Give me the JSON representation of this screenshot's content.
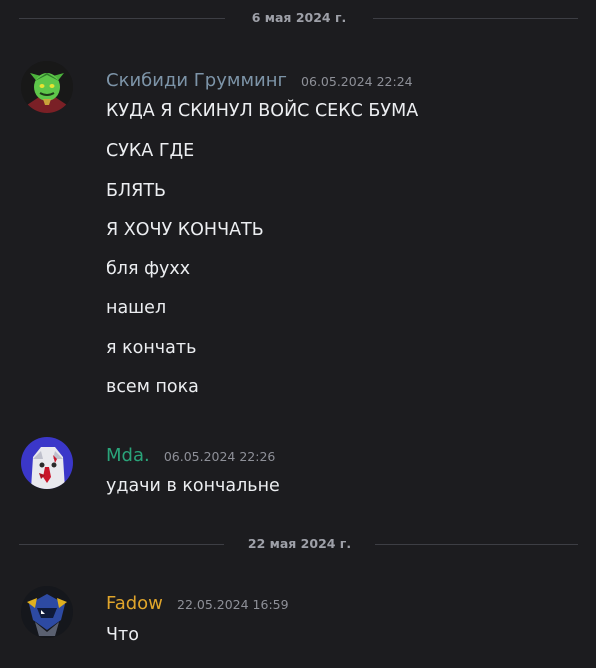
{
  "dividers": [
    {
      "label": "6 мая 2024 г."
    },
    {
      "label": "22 мая 2024 г."
    }
  ],
  "messages": [
    {
      "username": "Скибиди Грумминг",
      "username_color": "#7d94a8",
      "timestamp": "06.05.2024 22:24",
      "avatar_icon": "green-goblin-avatar",
      "lines": [
        "КУДА Я СКИНУЛ ВОЙС СЕКС БУМА",
        "СУКА ГДЕ",
        "БЛЯТЬ",
        "Я ХОЧУ КОНЧАТЬ",
        "бля фухх",
        "нашел",
        "я кончать",
        "всем пока"
      ]
    },
    {
      "username": "Mda.",
      "username_color": "#2aa47a",
      "timestamp": "06.05.2024 22:26",
      "avatar_icon": "bloody-face-avatar",
      "lines": [
        "удачи в кончальне"
      ]
    },
    {
      "username": "Fadow",
      "username_color": "#e0a52b",
      "timestamp": "22.05.2024 16:59",
      "avatar_icon": "blue-mech-avatar",
      "lines": [
        "Что"
      ]
    }
  ]
}
